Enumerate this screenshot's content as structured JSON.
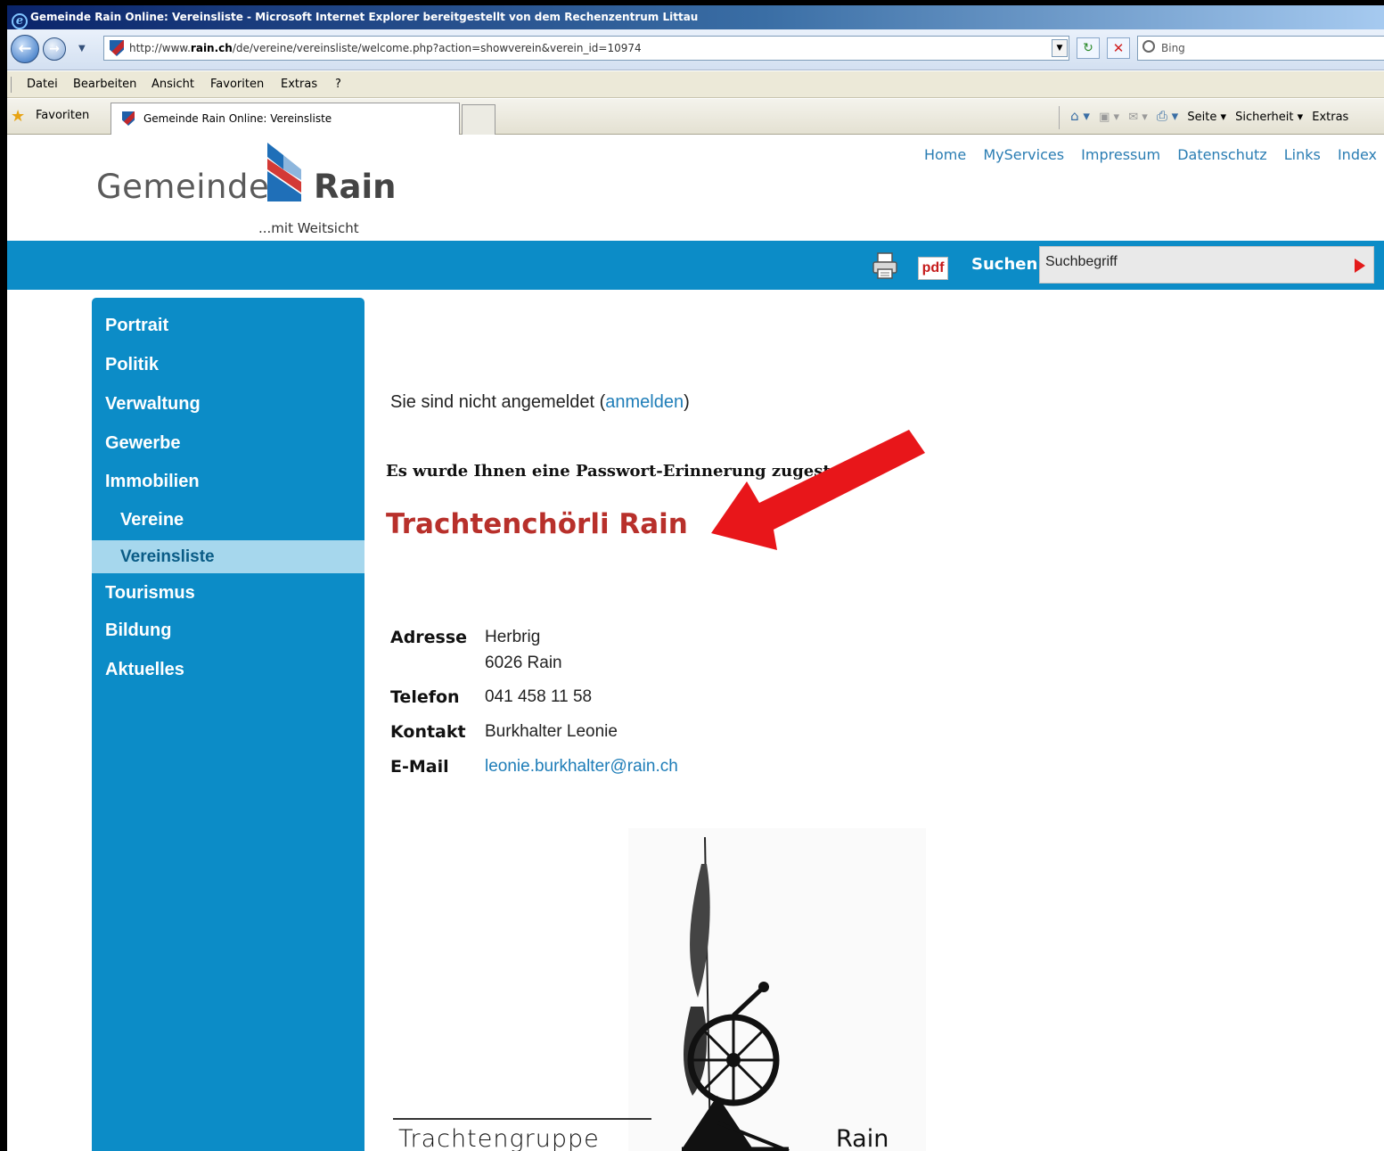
{
  "window": {
    "title": "Gemeinde Rain Online: Vereinsliste - Microsoft Internet Explorer bereitgestellt von dem Rechenzentrum Littau"
  },
  "address_bar": {
    "url_prefix": "http://www.",
    "url_host": "rain.ch",
    "url_path": "/de/vereine/vereinsliste/welcome.php?action=showverein&verein_id=10974",
    "search_placeholder": "Bing"
  },
  "menu": {
    "items": [
      "Datei",
      "Bearbeiten",
      "Ansicht",
      "Favoriten",
      "Extras",
      "?"
    ]
  },
  "favorites_bar": {
    "favorites_label": "Favoriten",
    "tab_title": "Gemeinde Rain Online: Vereinsliste",
    "commands": {
      "page": "Seite ▾",
      "security": "Sicherheit ▾",
      "extras": "Extras"
    }
  },
  "site": {
    "logo": {
      "word_left": "Gemeinde",
      "word_right": "Rain",
      "tagline": "...mit Weitsicht"
    },
    "top_links": [
      "Home",
      "MyServices",
      "Impressum",
      "Datenschutz",
      "Links",
      "Index"
    ],
    "search": {
      "label": "Suchen",
      "value": "Suchbegriff"
    },
    "pdf_label": "pdf",
    "nav": [
      {
        "label": "Portrait"
      },
      {
        "label": "Politik"
      },
      {
        "label": "Verwaltung"
      },
      {
        "label": "Gewerbe"
      },
      {
        "label": "Immobilien"
      },
      {
        "label": "Vereine"
      },
      {
        "label": "Vereinsliste"
      },
      {
        "label": "Tourismus"
      },
      {
        "label": "Bildung"
      },
      {
        "label": "Aktuelles"
      }
    ],
    "active_nav": "Vereinsliste"
  },
  "content": {
    "login_text_before": "Sie sind nicht angemeldet (",
    "login_link": "anmelden",
    "login_text_after": ")",
    "password_message": "Es wurde Ihnen eine Passwort-Erinnerung zugestellt.",
    "club_name": "Trachtenchörli Rain",
    "details": {
      "address_label": "Adresse",
      "address_line1": "Herbrig",
      "address_line2": "6026 Rain",
      "phone_label": "Telefon",
      "phone": "041 458 11 58",
      "contact_label": "Kontakt",
      "contact": "Burkhalter Leonie",
      "email_label": "E-Mail",
      "email": "leonie.burkhalter@rain.ch"
    },
    "image_caption_left": "Trachtengruppe",
    "image_caption_right": "Rain"
  },
  "colors": {
    "site_blue": "#0c8cc7",
    "active_nav_bg": "#a6d7ed",
    "title_red": "#b8302b",
    "link_blue": "#1e7db8",
    "annotation_arrow": "#e8161a"
  }
}
